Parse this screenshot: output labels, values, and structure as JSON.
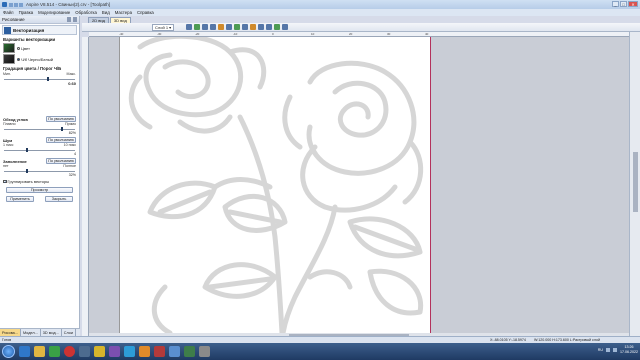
{
  "window": {
    "title": "Aspire V8.514 - Свиньи(2).crv - [Toolpath]",
    "controls": {
      "minimize": "_",
      "maximize": "□",
      "close": "✕"
    }
  },
  "menu": [
    "Файл",
    "Правка",
    "Моделирование",
    "Обработка",
    "Вид",
    "Мастера",
    "Справка"
  ],
  "panel": {
    "header": "Рисование",
    "pin": "◧",
    "help": "?",
    "close": "✕",
    "tool_title": "Векторизация",
    "modes_title": "Варианты векторизации",
    "mode_color": "Цвет",
    "mode_bw": "Ч/б Черно/Белый",
    "gradation_title": "Градация цвета / Порог Ч/Б",
    "gradation_min": "Мин.",
    "gradation_max": "Макс.",
    "gradation_value": "0.60",
    "gradation_level": 0.62,
    "corner_title": "Обход углов",
    "corner_default": "По умолчанию",
    "corner_left": "Плавно",
    "corner_right": "Прямо",
    "corner_value": "82%",
    "corner_level": 0.82,
    "noise_title": "Шум",
    "noise_default": "По умолчанию",
    "noise_left": "1 пикс",
    "noise_right": "10 пикс",
    "noise_value": "4",
    "noise_level": 0.33,
    "fill_title": "Заполнение",
    "fill_default": "По умолчанию",
    "fill_left": "нет",
    "fill_right": "Полное",
    "fill_value": "32%",
    "fill_level": 0.32,
    "group_label": "Группировать векторы",
    "preview_button": "Просмотр",
    "apply_button": "Применить",
    "close_button": "Закрыть",
    "bottom_tabs": [
      "Рисова...",
      "Модел...",
      "3D мод...",
      "Слои"
    ]
  },
  "doc_tabs": [
    "2D вид",
    "3D вид"
  ],
  "toolbar": {
    "layer_label": "Слой 1 ▾"
  },
  "ruler_top": [
    "-40",
    "-30",
    "-20",
    "-10",
    "0",
    "10",
    "20",
    "30",
    "40"
  ],
  "status": {
    "left": "Готов",
    "coords": "X:-88.0105 Y:-18.5974",
    "size": "W:120.000 H:173.600 L:Растровый слой"
  },
  "taskbar": {
    "lang": "RU",
    "time": "13:26",
    "date": "17.06.2022"
  },
  "colors": {
    "accent": "#1f5fb5",
    "sheet_border": "#b3325c",
    "sketch": "#d6d6d6"
  }
}
